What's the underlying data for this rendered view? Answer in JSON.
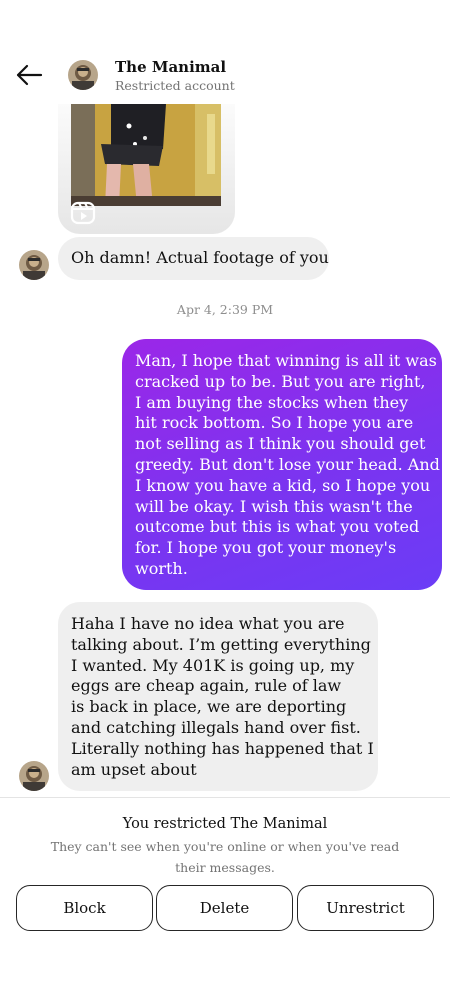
{
  "header": {
    "name": "The Manimal",
    "subtitle": "Restricted account"
  },
  "messages": {
    "incoming_1": "Oh damn! Actual footage of you",
    "timestamp": "Apr 4, 2:39 PM",
    "outgoing_1_lines": [
      "Man, I hope that winning is all it was",
      "cracked up to be. But you are right,",
      "I am buying the stocks when they",
      "hit rock bottom. So I hope you are",
      "not selling as I think you should get",
      "greedy. But don't lose your head. And",
      "I know you have a kid, so I hope you",
      "will be okay. I wish this wasn't the",
      "outcome but this is what you voted",
      "for. I hope you got your money's",
      "worth."
    ],
    "incoming_2_lines": [
      "Haha I have no idea what you are",
      "talking about. I’m getting everything",
      "I wanted. My 401K is going up, my",
      "eggs are cheap again, rule of law",
      "is back in place, we are deporting",
      "and catching illegals hand over fist.",
      "Literally nothing has happened that I",
      "am upset about"
    ]
  },
  "restriction": {
    "title": "You restricted The Manimal",
    "description": "They can't see when you're online or when you've read their messages.",
    "buttons": {
      "block": "Block",
      "delete": "Delete",
      "unrestrict": "Unrestrict"
    }
  },
  "icons": {
    "back": "arrow-left-icon",
    "reel": "reel-icon"
  },
  "colors": {
    "outgoing_bubble_start": "#9b27e8",
    "outgoing_bubble_end": "#6b3cf6",
    "incoming_bubble": "#efefef"
  }
}
